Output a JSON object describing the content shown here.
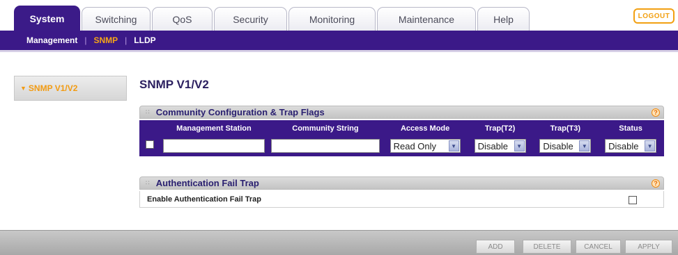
{
  "tabs": [
    "System",
    "Switching",
    "QoS",
    "Security",
    "Monitoring",
    "Maintenance",
    "Help"
  ],
  "logout_label": "LOGOUT",
  "subnav": [
    "Management",
    "SNMP",
    "LLDP"
  ],
  "sidebar": {
    "item_label": "SNMP V1/V2"
  },
  "page_title": "SNMP V1/V2",
  "community": {
    "title": "Community Configuration & Trap Flags",
    "columns": [
      "Management Station",
      "Community String",
      "Access Mode",
      "Trap(T2)",
      "Trap(T3)",
      "Status"
    ],
    "row": {
      "management_station": "",
      "community_string": "",
      "access_mode": "Read Only",
      "trap_t2": "Disable",
      "trap_t3": "Disable",
      "status": "Disable"
    }
  },
  "auth_trap": {
    "title": "Authentication Fail Trap",
    "label": "Enable Authentication Fail Trap"
  },
  "buttons": {
    "add": "ADD",
    "delete": "DELETE",
    "cancel": "CANCEL",
    "apply": "APPLY"
  },
  "help_glyph": "?",
  "colors": {
    "nav_purple": "#3b1988",
    "accent_orange": "#f29b12",
    "title_navy": "#2c2060"
  }
}
